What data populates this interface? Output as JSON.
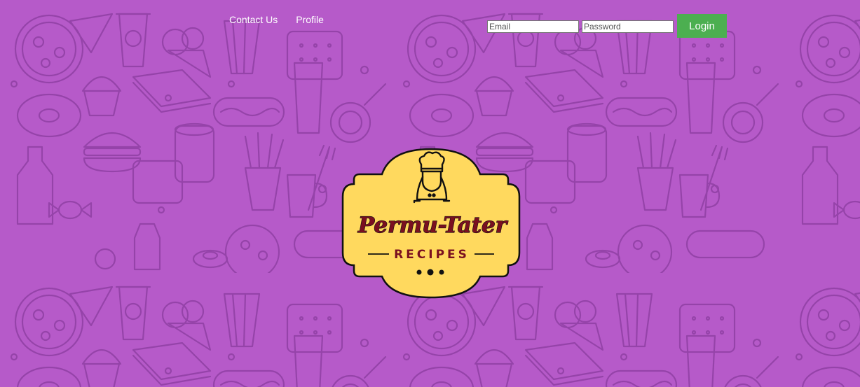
{
  "nav": {
    "items": [
      {
        "label": "Contact Us"
      },
      {
        "label": "Profile"
      }
    ]
  },
  "login": {
    "email_placeholder": "Email",
    "password_placeholder": "Password",
    "button_label": "Login"
  },
  "logo": {
    "title": "Permu-Tater",
    "subtitle": "RECIPES"
  },
  "colors": {
    "background": "#b65ac9",
    "pattern_lines": "#8f3fa3",
    "login_button": "#4caf50",
    "logo_fill": "#ffd95e",
    "logo_text": "#7a1020"
  },
  "background_pattern": [
    "pizza-icon",
    "soda-cup-icon",
    "ice-cream-icon",
    "cracker-icon",
    "sandwich-icon",
    "hot-dog-icon",
    "donut-icon",
    "burger-icon",
    "candy-icon",
    "cupcake-icon",
    "fries-icon",
    "bottle-icon",
    "lollipop-icon",
    "popcorn-icon"
  ]
}
